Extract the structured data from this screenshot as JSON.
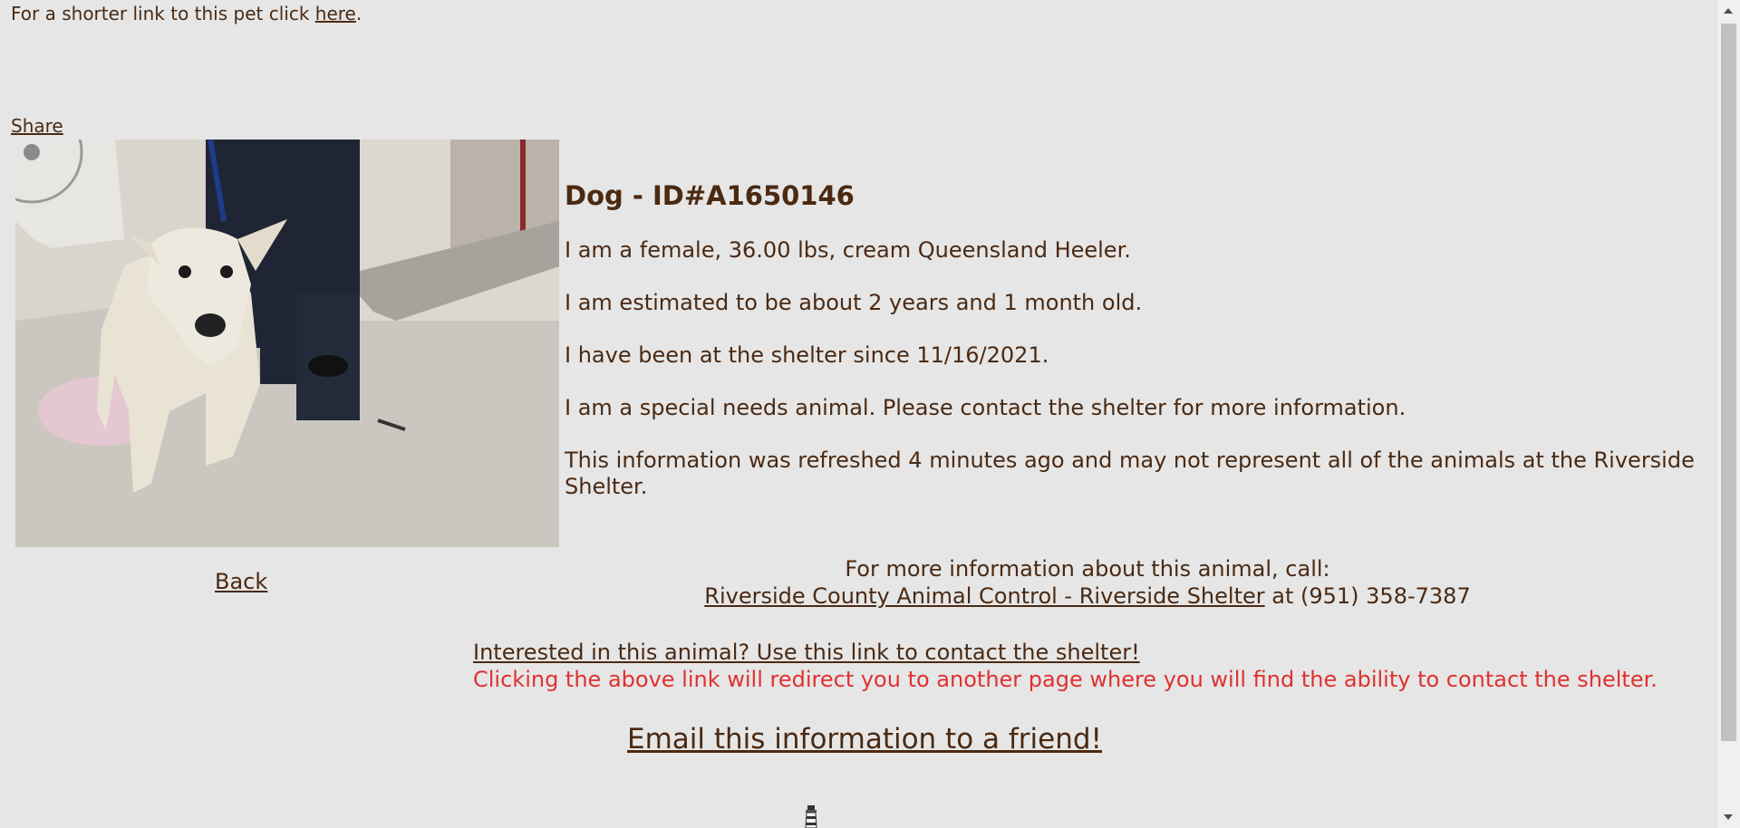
{
  "top_note": {
    "prefix": "For a shorter link to this pet click ",
    "link": "here",
    "suffix": "."
  },
  "share_label": "Share",
  "back_label": "Back",
  "animal": {
    "title": "Dog - ID#A1650146",
    "description": "I am a female, 36.00 lbs, cream Queensland Heeler.",
    "age": "I am estimated to be about 2 years and 1 month old.",
    "since": "I have been at the shelter since 11/16/2021.",
    "special_needs": "I am a special needs animal. Please contact the shelter for more information.",
    "refresh": "This information was refreshed 4 minutes ago and may not represent all of the animals at the Riverside Shelter."
  },
  "contact": {
    "line1": "For more information about this animal, call:",
    "shelter_link": "Riverside County Animal Control - Riverside Shelter",
    "phone_text": " at (951) 358-7387"
  },
  "interested": {
    "link": "Interested in this animal? Use this link to contact the shelter!",
    "note": "Clicking the above link will redirect you to another page where you will find the ability to contact the shelter."
  },
  "email_label": "Email this information to a friend!",
  "colors": {
    "background": "#e6e6e6",
    "text": "#4b2a12",
    "warning": "#e03131"
  },
  "icons": {
    "photo": "dog-photo",
    "bottom": "lighthouse-icon"
  }
}
